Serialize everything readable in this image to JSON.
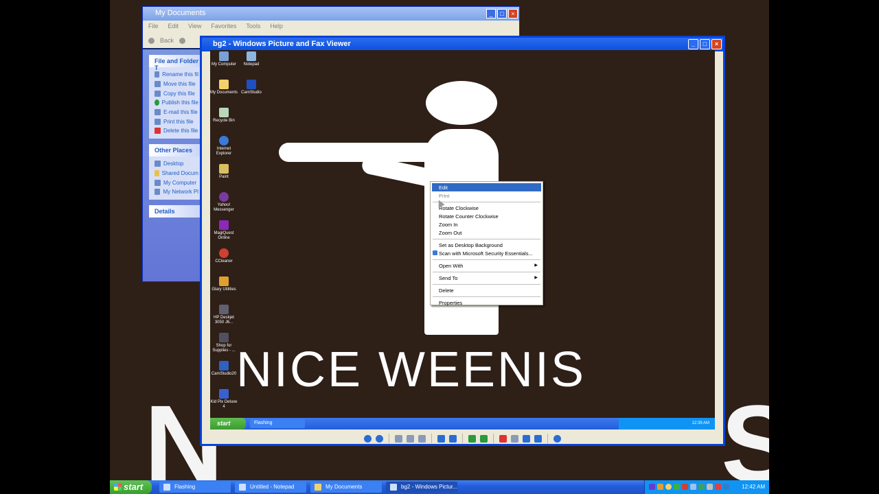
{
  "my_documents": {
    "title": "My Documents",
    "menu": [
      "File",
      "Edit",
      "View",
      "Favorites",
      "Tools",
      "Help"
    ],
    "toolbar_back": "Back",
    "file_tasks": {
      "header": "File and Folder T",
      "items": [
        "Rename this fil",
        "Move this file",
        "Copy this file",
        "Publish this file",
        "E-mail this file",
        "Print this file",
        "Delete this file"
      ]
    },
    "other_places": {
      "header": "Other Places",
      "items": [
        "Desktop",
        "Shared Docum",
        "My Computer",
        "My Network Pl"
      ]
    },
    "details": {
      "header": "Details"
    }
  },
  "viewer": {
    "title": "bg2 - Windows Picture and Fax Viewer",
    "image_text": "NICE WEENIS",
    "desktop_icons": [
      {
        "label": "My Computer",
        "color": "#7aa0d8"
      },
      {
        "label": "Notepad",
        "color": "#8cb8e0"
      },
      {
        "label": "My Documents",
        "color": "#f2d36b"
      },
      {
        "label": "CamStudio",
        "color": "#2050c0"
      },
      {
        "label": "Recycle Bin",
        "color": "#b8d8b8"
      },
      {
        "label": "Internet Explorer",
        "color": "#3a7ad8"
      },
      {
        "label": "Paint",
        "color": "#d8c060"
      },
      {
        "label": "Yahoo! Messenger",
        "color": "#7a3aa0"
      },
      {
        "label": "MagiQuest Online",
        "color": "#8a2ab8"
      },
      {
        "label": "CCleaner",
        "color": "#d04030"
      },
      {
        "label": "Glary Utilities",
        "color": "#e0a030"
      },
      {
        "label": "HP Deskjet 3050 J6...",
        "color": "#606070"
      },
      {
        "label": "Shop for Supplies - ...",
        "color": "#505060"
      },
      {
        "label": "CamStudio20",
        "color": "#3060c0"
      },
      {
        "label": "Kid Pix Deluxe 4",
        "color": "#3a60d0"
      }
    ],
    "inner_taskbar": {
      "start": "start",
      "button": "Flashing",
      "clock": "12:39 AM"
    }
  },
  "context_menu": {
    "items": {
      "edit": "Edit",
      "print": "Print",
      "rotate_cw": "Rotate Clockwise",
      "rotate_ccw": "Rotate Counter Clockwise",
      "zoom_in": "Zoom In",
      "zoom_out": "Zoom Out",
      "set_desktop_bg": "Set as Desktop Background",
      "scan_mse": "Scan with Microsoft Security Essentials...",
      "open_with": "Open With",
      "send_to": "Send To",
      "delete": "Delete",
      "properties": "Properties"
    }
  },
  "taskbar": {
    "start": "start",
    "buttons": [
      "Flashing",
      "Untitled - Notepad",
      "My Documents",
      "bg2 - Windows Pictur..."
    ],
    "clock": "12:42 AM"
  }
}
